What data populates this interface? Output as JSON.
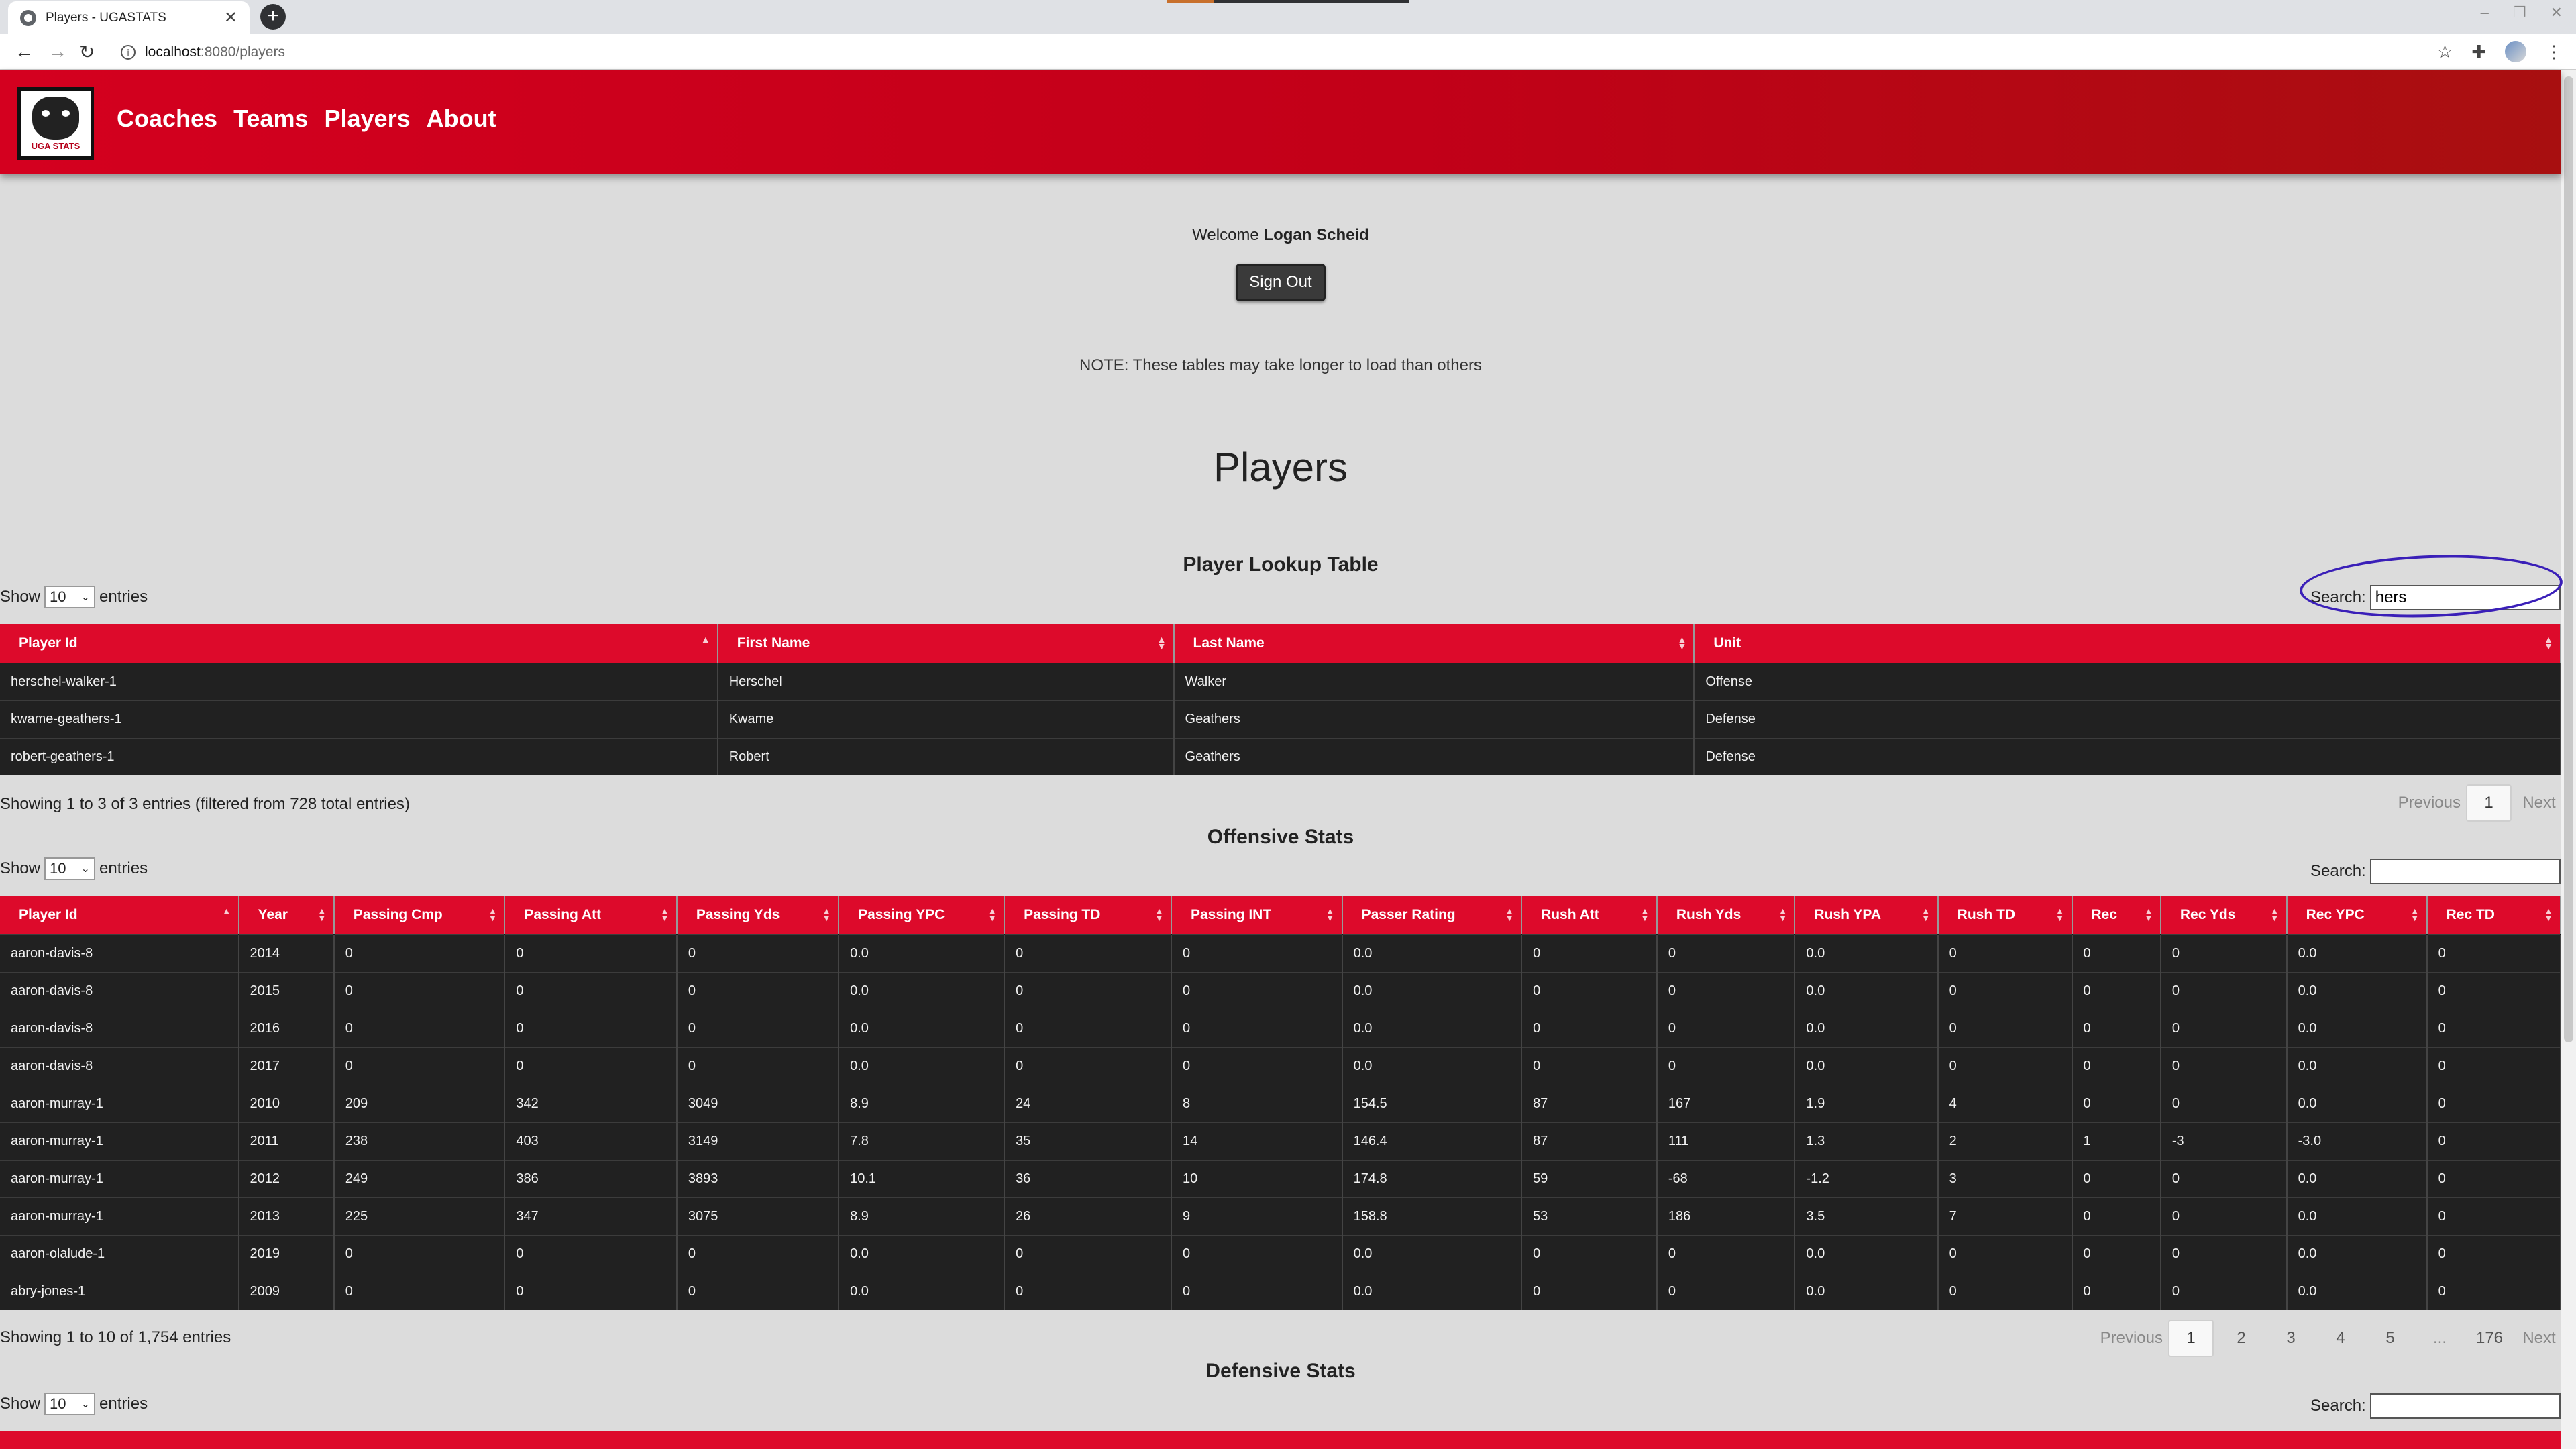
{
  "browser": {
    "tab_title": "Players - UGASTATS",
    "url_host": "localhost",
    "url_path": ":8080/players"
  },
  "nav": {
    "logo_text": "UGA STATS",
    "links": [
      "Coaches",
      "Teams",
      "Players",
      "About"
    ]
  },
  "welcome": {
    "prefix": "Welcome",
    "user": "Logan Scheid",
    "signout_label": "Sign Out"
  },
  "note": "NOTE: These tables may take longer to load than others",
  "page_title": "Players",
  "lookup": {
    "title": "Player Lookup Table",
    "show_label": "Show",
    "entries_label": "entries",
    "page_size": "10",
    "search_label": "Search:",
    "search_value": "hers",
    "columns": [
      "Player Id",
      "First Name",
      "Last Name",
      "Unit"
    ],
    "rows": [
      [
        "herschel-walker-1",
        "Herschel",
        "Walker",
        "Offense"
      ],
      [
        "kwame-geathers-1",
        "Kwame",
        "Geathers",
        "Defense"
      ],
      [
        "robert-geathers-1",
        "Robert",
        "Geathers",
        "Defense"
      ]
    ],
    "info": "Showing 1 to 3 of 3 entries (filtered from 728 total entries)",
    "pager": [
      "Previous",
      "1",
      "Next"
    ]
  },
  "offense": {
    "title": "Offensive Stats",
    "show_label": "Show",
    "entries_label": "entries",
    "page_size": "10",
    "search_label": "Search:",
    "search_value": "",
    "columns": [
      "Player Id",
      "Year",
      "Passing Cmp",
      "Passing Att",
      "Passing Yds",
      "Passing YPC",
      "Passing TD",
      "Passing INT",
      "Passer Rating",
      "Rush Att",
      "Rush Yds",
      "Rush YPA",
      "Rush TD",
      "Rec",
      "Rec Yds",
      "Rec YPC",
      "Rec TD"
    ],
    "rows": [
      [
        "aaron-davis-8",
        "2014",
        "0",
        "0",
        "0",
        "0.0",
        "0",
        "0",
        "0.0",
        "0",
        "0",
        "0.0",
        "0",
        "0",
        "0",
        "0.0",
        "0"
      ],
      [
        "aaron-davis-8",
        "2015",
        "0",
        "0",
        "0",
        "0.0",
        "0",
        "0",
        "0.0",
        "0",
        "0",
        "0.0",
        "0",
        "0",
        "0",
        "0.0",
        "0"
      ],
      [
        "aaron-davis-8",
        "2016",
        "0",
        "0",
        "0",
        "0.0",
        "0",
        "0",
        "0.0",
        "0",
        "0",
        "0.0",
        "0",
        "0",
        "0",
        "0.0",
        "0"
      ],
      [
        "aaron-davis-8",
        "2017",
        "0",
        "0",
        "0",
        "0.0",
        "0",
        "0",
        "0.0",
        "0",
        "0",
        "0.0",
        "0",
        "0",
        "0",
        "0.0",
        "0"
      ],
      [
        "aaron-murray-1",
        "2010",
        "209",
        "342",
        "3049",
        "8.9",
        "24",
        "8",
        "154.5",
        "87",
        "167",
        "1.9",
        "4",
        "0",
        "0",
        "0.0",
        "0"
      ],
      [
        "aaron-murray-1",
        "2011",
        "238",
        "403",
        "3149",
        "7.8",
        "35",
        "14",
        "146.4",
        "87",
        "111",
        "1.3",
        "2",
        "1",
        "-3",
        "-3.0",
        "0"
      ],
      [
        "aaron-murray-1",
        "2012",
        "249",
        "386",
        "3893",
        "10.1",
        "36",
        "10",
        "174.8",
        "59",
        "-68",
        "-1.2",
        "3",
        "0",
        "0",
        "0.0",
        "0"
      ],
      [
        "aaron-murray-1",
        "2013",
        "225",
        "347",
        "3075",
        "8.9",
        "26",
        "9",
        "158.8",
        "53",
        "186",
        "3.5",
        "7",
        "0",
        "0",
        "0.0",
        "0"
      ],
      [
        "aaron-olalude-1",
        "2019",
        "0",
        "0",
        "0",
        "0.0",
        "0",
        "0",
        "0.0",
        "0",
        "0",
        "0.0",
        "0",
        "0",
        "0",
        "0.0",
        "0"
      ],
      [
        "abry-jones-1",
        "2009",
        "0",
        "0",
        "0",
        "0.0",
        "0",
        "0",
        "0.0",
        "0",
        "0",
        "0.0",
        "0",
        "0",
        "0",
        "0.0",
        "0"
      ]
    ],
    "info": "Showing 1 to 10 of 1,754 entries",
    "pager": [
      "Previous",
      "1",
      "2",
      "3",
      "4",
      "5",
      "...",
      "176",
      "Next"
    ]
  },
  "defense": {
    "title": "Defensive Stats",
    "show_label": "Show",
    "entries_label": "entries",
    "page_size": "10",
    "search_label": "Search:",
    "search_value": ""
  }
}
